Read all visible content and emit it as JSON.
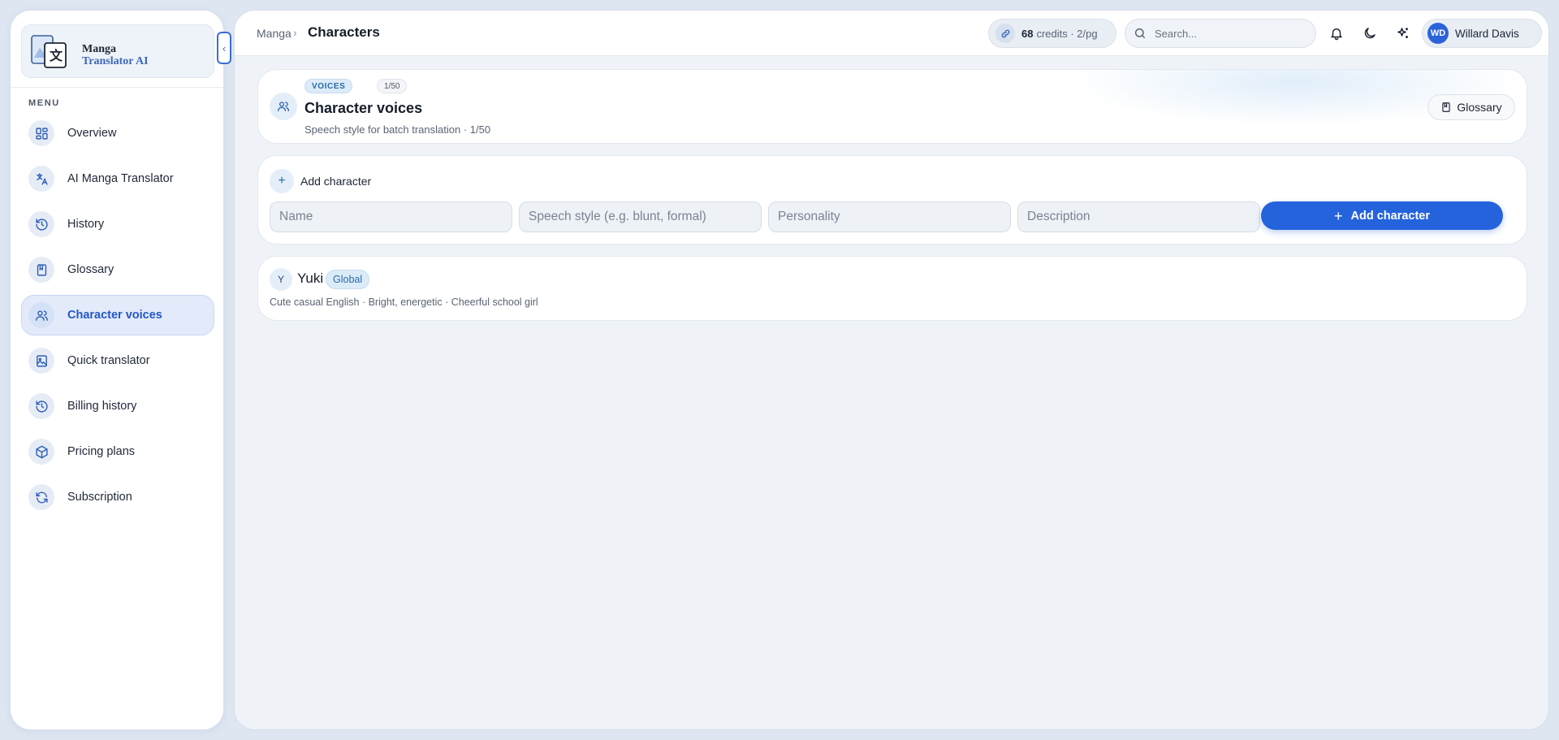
{
  "brand": {
    "line1": "Manga",
    "line2": "Translator AI"
  },
  "sidebar": {
    "menu_label": "MENU",
    "items": [
      {
        "label": "Overview",
        "icon": "dashboard-icon"
      },
      {
        "label": "AI Manga Translator",
        "icon": "translate-icon"
      },
      {
        "label": "History",
        "icon": "history-icon"
      },
      {
        "label": "Glossary",
        "icon": "book-icon"
      },
      {
        "label": "Character voices",
        "icon": "users-icon",
        "active": true
      },
      {
        "label": "Quick translator",
        "icon": "image-file-icon"
      },
      {
        "label": "Billing history",
        "icon": "history-icon"
      },
      {
        "label": "Pricing plans",
        "icon": "package-icon"
      },
      {
        "label": "Subscription",
        "icon": "refresh-icon"
      }
    ]
  },
  "topbar": {
    "breadcrumb_parent": "Manga",
    "breadcrumb_sep": "›",
    "breadcrumb_current": "Characters",
    "credits_count": "68",
    "credits_rest": "credits · 2/pg",
    "search_placeholder": "Search...",
    "user_initials": "WD",
    "user_name": "Willard Davis"
  },
  "header": {
    "badge": "VOICES",
    "count": "1/50",
    "title": "Character voices",
    "subtitle": "Speech style for batch translation · 1/50",
    "glossary_button": "Glossary"
  },
  "add_form": {
    "heading": "Add character",
    "name_placeholder": "Name",
    "speech_placeholder": "Speech style (e.g. blunt, formal)",
    "personality_placeholder": "Personality",
    "description_placeholder": "Description",
    "submit_label": "Add character"
  },
  "characters": [
    {
      "initial": "Y",
      "name": "Yuki",
      "scope": "Global",
      "details": "Cute casual English · Bright, energetic · Cheerful school girl"
    }
  ],
  "colors": {
    "accent": "#2563dc",
    "active_bg": "#e3ebfa",
    "badge_bg": "#dcebf8"
  }
}
